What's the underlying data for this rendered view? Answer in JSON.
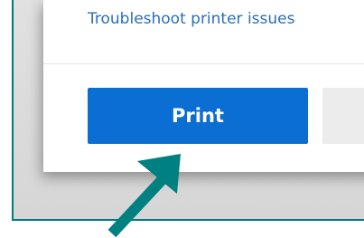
{
  "dialog": {
    "troubleshoot_link": "Troubleshoot printer issues",
    "print_button_label": "Print",
    "cancel_button_label": ""
  },
  "colors": {
    "accent": "#0a6ed3",
    "link": "#2a6fb8",
    "annotation_arrow": "#008080",
    "frame_border": "#007a7a"
  },
  "icons": {
    "annotation": "arrow-up-right-icon"
  }
}
